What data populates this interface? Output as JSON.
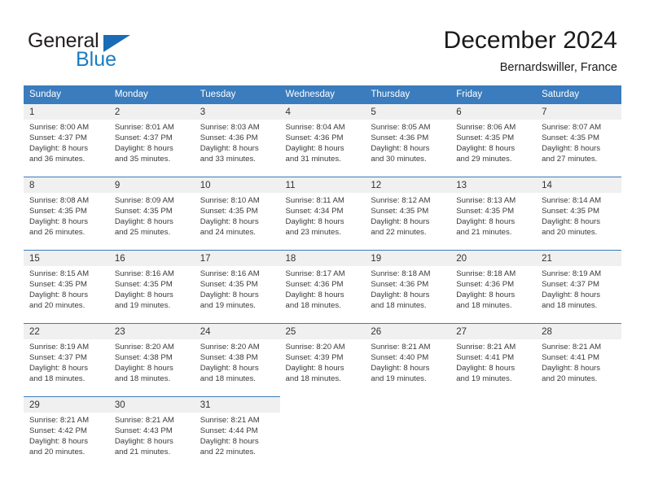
{
  "brand": {
    "name_part1": "General",
    "name_part2": "Blue",
    "triangle_icon": "triangle-icon",
    "color_dark": "#231f20",
    "color_blue": "#1a7cc4"
  },
  "header": {
    "title": "December 2024",
    "subtitle": "Bernardswiller, France"
  },
  "colors": {
    "header_blue": "#3a7cbd",
    "daynum_bg": "#f0f0f0",
    "cell_bg": "#ffffff",
    "text": "#3a3a3a"
  },
  "weekday_headers": [
    "Sunday",
    "Monday",
    "Tuesday",
    "Wednesday",
    "Thursday",
    "Friday",
    "Saturday"
  ],
  "weeks": [
    {
      "days": [
        {
          "num": "1",
          "sunrise": "Sunrise: 8:00 AM",
          "sunset": "Sunset: 4:37 PM",
          "daylight1": "Daylight: 8 hours",
          "daylight2": "and 36 minutes."
        },
        {
          "num": "2",
          "sunrise": "Sunrise: 8:01 AM",
          "sunset": "Sunset: 4:37 PM",
          "daylight1": "Daylight: 8 hours",
          "daylight2": "and 35 minutes."
        },
        {
          "num": "3",
          "sunrise": "Sunrise: 8:03 AM",
          "sunset": "Sunset: 4:36 PM",
          "daylight1": "Daylight: 8 hours",
          "daylight2": "and 33 minutes."
        },
        {
          "num": "4",
          "sunrise": "Sunrise: 8:04 AM",
          "sunset": "Sunset: 4:36 PM",
          "daylight1": "Daylight: 8 hours",
          "daylight2": "and 31 minutes."
        },
        {
          "num": "5",
          "sunrise": "Sunrise: 8:05 AM",
          "sunset": "Sunset: 4:36 PM",
          "daylight1": "Daylight: 8 hours",
          "daylight2": "and 30 minutes."
        },
        {
          "num": "6",
          "sunrise": "Sunrise: 8:06 AM",
          "sunset": "Sunset: 4:35 PM",
          "daylight1": "Daylight: 8 hours",
          "daylight2": "and 29 minutes."
        },
        {
          "num": "7",
          "sunrise": "Sunrise: 8:07 AM",
          "sunset": "Sunset: 4:35 PM",
          "daylight1": "Daylight: 8 hours",
          "daylight2": "and 27 minutes."
        }
      ]
    },
    {
      "days": [
        {
          "num": "8",
          "sunrise": "Sunrise: 8:08 AM",
          "sunset": "Sunset: 4:35 PM",
          "daylight1": "Daylight: 8 hours",
          "daylight2": "and 26 minutes."
        },
        {
          "num": "9",
          "sunrise": "Sunrise: 8:09 AM",
          "sunset": "Sunset: 4:35 PM",
          "daylight1": "Daylight: 8 hours",
          "daylight2": "and 25 minutes."
        },
        {
          "num": "10",
          "sunrise": "Sunrise: 8:10 AM",
          "sunset": "Sunset: 4:35 PM",
          "daylight1": "Daylight: 8 hours",
          "daylight2": "and 24 minutes."
        },
        {
          "num": "11",
          "sunrise": "Sunrise: 8:11 AM",
          "sunset": "Sunset: 4:34 PM",
          "daylight1": "Daylight: 8 hours",
          "daylight2": "and 23 minutes."
        },
        {
          "num": "12",
          "sunrise": "Sunrise: 8:12 AM",
          "sunset": "Sunset: 4:35 PM",
          "daylight1": "Daylight: 8 hours",
          "daylight2": "and 22 minutes."
        },
        {
          "num": "13",
          "sunrise": "Sunrise: 8:13 AM",
          "sunset": "Sunset: 4:35 PM",
          "daylight1": "Daylight: 8 hours",
          "daylight2": "and 21 minutes."
        },
        {
          "num": "14",
          "sunrise": "Sunrise: 8:14 AM",
          "sunset": "Sunset: 4:35 PM",
          "daylight1": "Daylight: 8 hours",
          "daylight2": "and 20 minutes."
        }
      ]
    },
    {
      "days": [
        {
          "num": "15",
          "sunrise": "Sunrise: 8:15 AM",
          "sunset": "Sunset: 4:35 PM",
          "daylight1": "Daylight: 8 hours",
          "daylight2": "and 20 minutes."
        },
        {
          "num": "16",
          "sunrise": "Sunrise: 8:16 AM",
          "sunset": "Sunset: 4:35 PM",
          "daylight1": "Daylight: 8 hours",
          "daylight2": "and 19 minutes."
        },
        {
          "num": "17",
          "sunrise": "Sunrise: 8:16 AM",
          "sunset": "Sunset: 4:35 PM",
          "daylight1": "Daylight: 8 hours",
          "daylight2": "and 19 minutes."
        },
        {
          "num": "18",
          "sunrise": "Sunrise: 8:17 AM",
          "sunset": "Sunset: 4:36 PM",
          "daylight1": "Daylight: 8 hours",
          "daylight2": "and 18 minutes."
        },
        {
          "num": "19",
          "sunrise": "Sunrise: 8:18 AM",
          "sunset": "Sunset: 4:36 PM",
          "daylight1": "Daylight: 8 hours",
          "daylight2": "and 18 minutes."
        },
        {
          "num": "20",
          "sunrise": "Sunrise: 8:18 AM",
          "sunset": "Sunset: 4:36 PM",
          "daylight1": "Daylight: 8 hours",
          "daylight2": "and 18 minutes."
        },
        {
          "num": "21",
          "sunrise": "Sunrise: 8:19 AM",
          "sunset": "Sunset: 4:37 PM",
          "daylight1": "Daylight: 8 hours",
          "daylight2": "and 18 minutes."
        }
      ]
    },
    {
      "days": [
        {
          "num": "22",
          "sunrise": "Sunrise: 8:19 AM",
          "sunset": "Sunset: 4:37 PM",
          "daylight1": "Daylight: 8 hours",
          "daylight2": "and 18 minutes."
        },
        {
          "num": "23",
          "sunrise": "Sunrise: 8:20 AM",
          "sunset": "Sunset: 4:38 PM",
          "daylight1": "Daylight: 8 hours",
          "daylight2": "and 18 minutes."
        },
        {
          "num": "24",
          "sunrise": "Sunrise: 8:20 AM",
          "sunset": "Sunset: 4:38 PM",
          "daylight1": "Daylight: 8 hours",
          "daylight2": "and 18 minutes."
        },
        {
          "num": "25",
          "sunrise": "Sunrise: 8:20 AM",
          "sunset": "Sunset: 4:39 PM",
          "daylight1": "Daylight: 8 hours",
          "daylight2": "and 18 minutes."
        },
        {
          "num": "26",
          "sunrise": "Sunrise: 8:21 AM",
          "sunset": "Sunset: 4:40 PM",
          "daylight1": "Daylight: 8 hours",
          "daylight2": "and 19 minutes."
        },
        {
          "num": "27",
          "sunrise": "Sunrise: 8:21 AM",
          "sunset": "Sunset: 4:41 PM",
          "daylight1": "Daylight: 8 hours",
          "daylight2": "and 19 minutes."
        },
        {
          "num": "28",
          "sunrise": "Sunrise: 8:21 AM",
          "sunset": "Sunset: 4:41 PM",
          "daylight1": "Daylight: 8 hours",
          "daylight2": "and 20 minutes."
        }
      ]
    },
    {
      "days": [
        {
          "num": "29",
          "sunrise": "Sunrise: 8:21 AM",
          "sunset": "Sunset: 4:42 PM",
          "daylight1": "Daylight: 8 hours",
          "daylight2": "and 20 minutes."
        },
        {
          "num": "30",
          "sunrise": "Sunrise: 8:21 AM",
          "sunset": "Sunset: 4:43 PM",
          "daylight1": "Daylight: 8 hours",
          "daylight2": "and 21 minutes."
        },
        {
          "num": "31",
          "sunrise": "Sunrise: 8:21 AM",
          "sunset": "Sunset: 4:44 PM",
          "daylight1": "Daylight: 8 hours",
          "daylight2": "and 22 minutes."
        },
        {
          "num": "",
          "sunrise": "",
          "sunset": "",
          "daylight1": "",
          "daylight2": ""
        },
        {
          "num": "",
          "sunrise": "",
          "sunset": "",
          "daylight1": "",
          "daylight2": ""
        },
        {
          "num": "",
          "sunrise": "",
          "sunset": "",
          "daylight1": "",
          "daylight2": ""
        },
        {
          "num": "",
          "sunrise": "",
          "sunset": "",
          "daylight1": "",
          "daylight2": ""
        }
      ]
    }
  ]
}
